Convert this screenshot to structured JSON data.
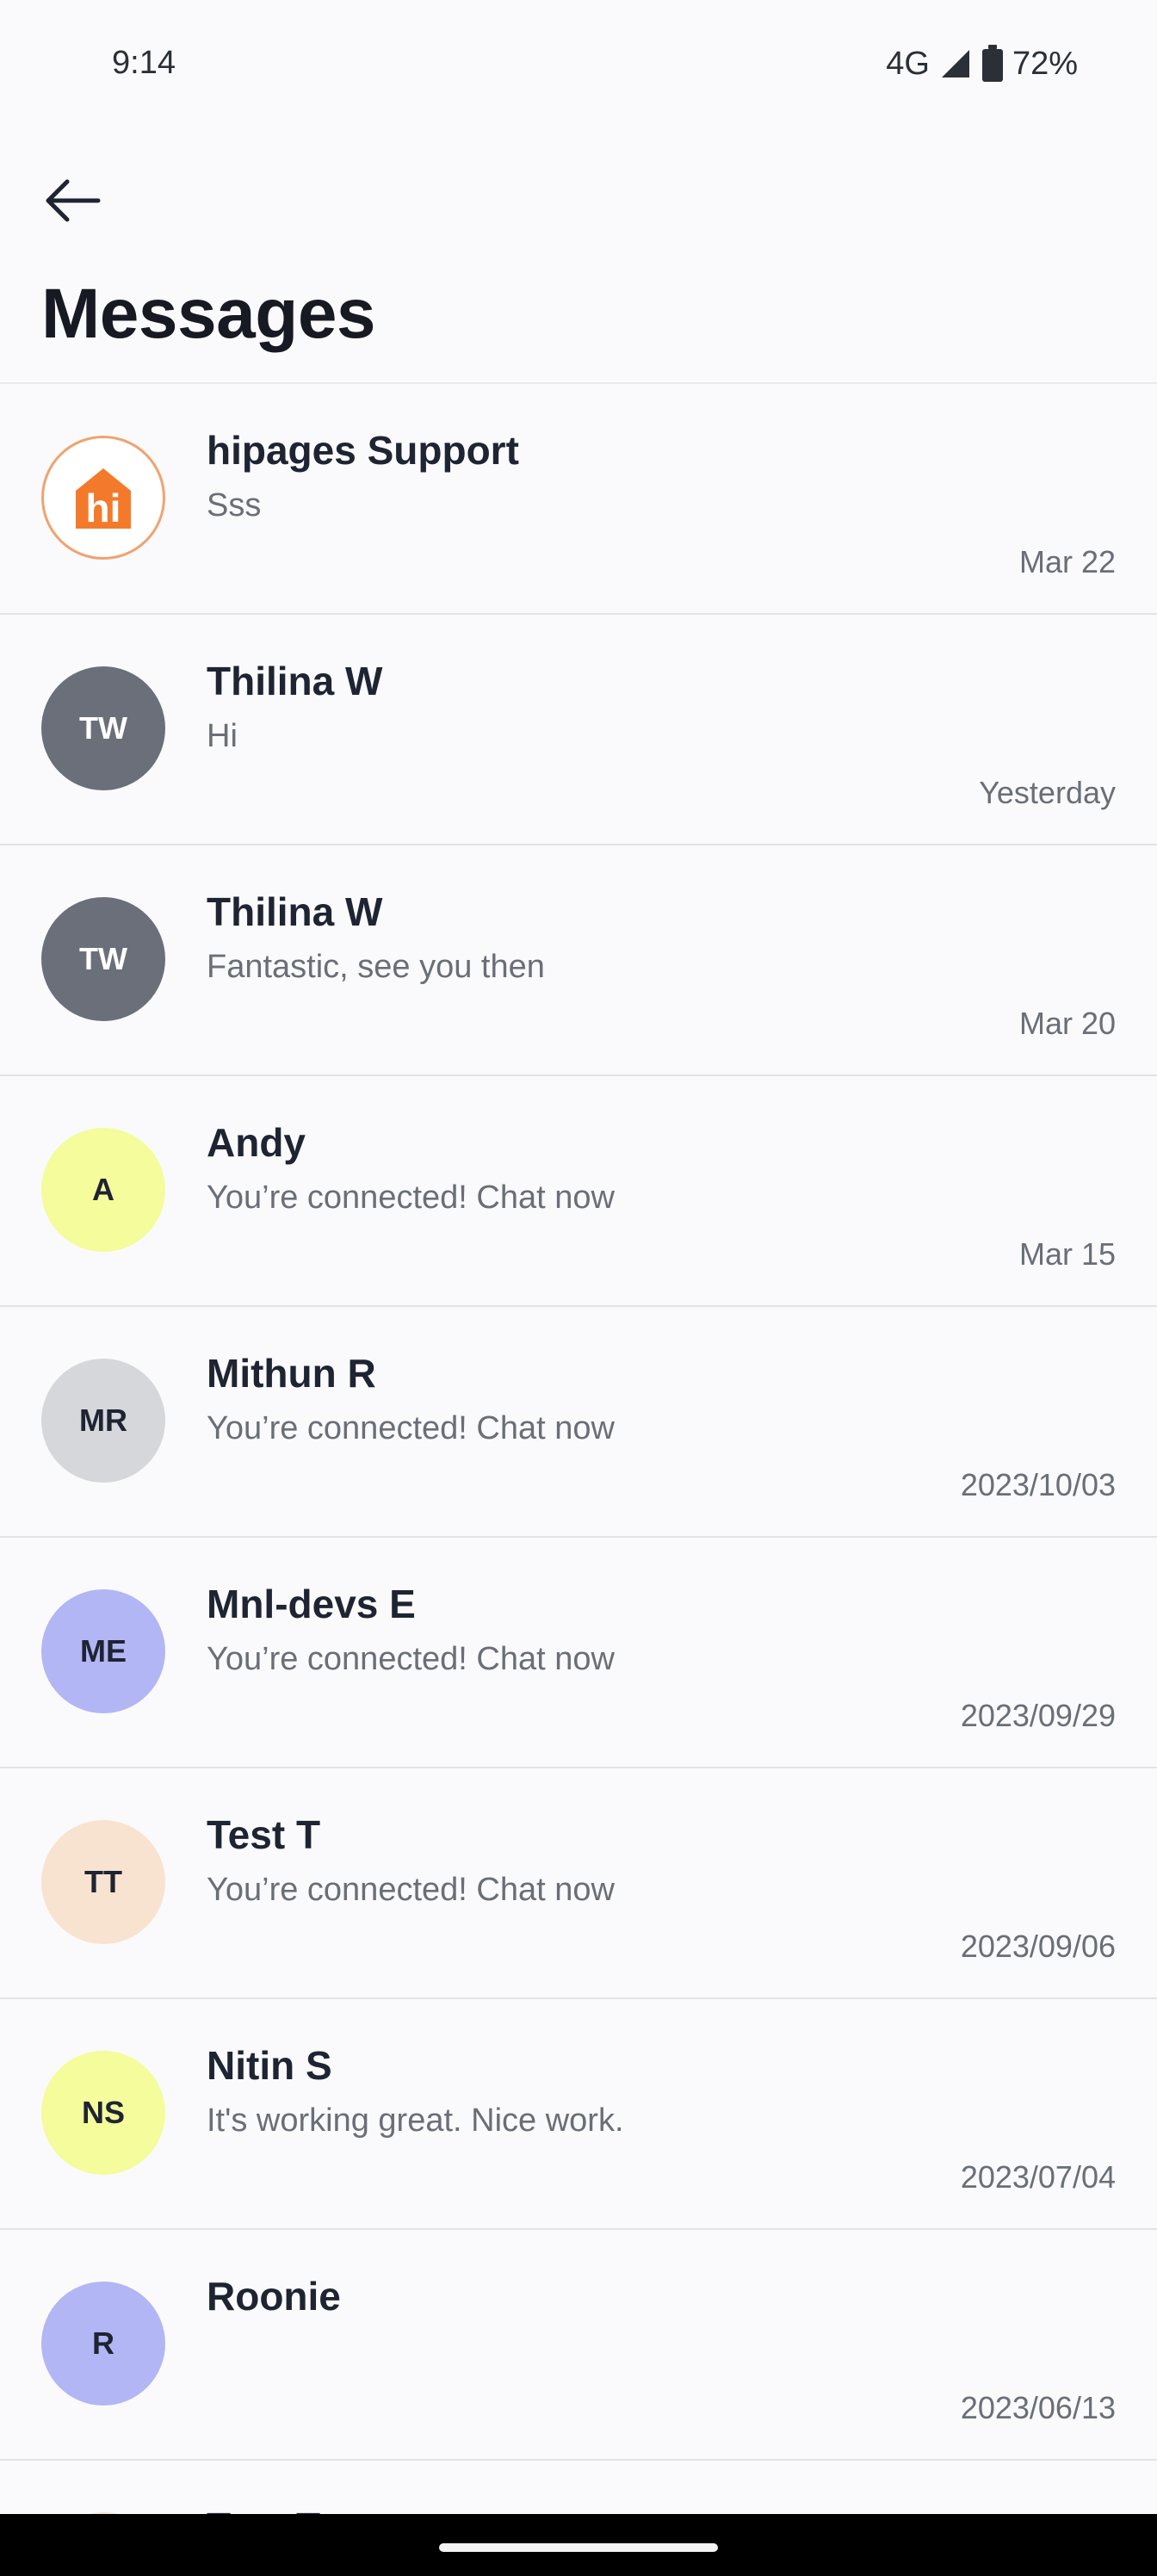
{
  "status": {
    "time": "9:14",
    "network": "4G",
    "battery": "72%"
  },
  "header": {
    "title": "Messages"
  },
  "conversations": [
    {
      "initials": "",
      "name": "hipages Support",
      "preview": "Sss",
      "time": "Mar 22",
      "avatar_color": "#FFFFFF",
      "logo": "hi"
    },
    {
      "initials": "TW",
      "name": "Thilina W",
      "preview": "Hi",
      "time": "Yesterday",
      "avatar_color": "#6B6F7A"
    },
    {
      "initials": "TW",
      "name": "Thilina W",
      "preview": "Fantastic, see you then",
      "time": "Mar 20",
      "avatar_color": "#6B6F7A"
    },
    {
      "initials": "A",
      "name": "Andy",
      "preview": "You’re connected! Chat now",
      "time": "Mar 15",
      "avatar_color": "#F4FC9B"
    },
    {
      "initials": "MR",
      "name": "Mithun R",
      "preview": "You’re connected! Chat now",
      "time": "2023/10/03",
      "avatar_color": "#D6D7DB"
    },
    {
      "initials": "ME",
      "name": "Mnl-devs E",
      "preview": "You’re connected! Chat now",
      "time": "2023/09/29",
      "avatar_color": "#B3B6F4"
    },
    {
      "initials": "TT",
      "name": "Test T",
      "preview": "You’re connected! Chat now",
      "time": "2023/09/06",
      "avatar_color": "#F7E3D0"
    },
    {
      "initials": "NS",
      "name": "Nitin S",
      "preview": "It's working great. Nice work.",
      "time": "2023/07/04",
      "avatar_color": "#F4FC9B"
    },
    {
      "initials": "R",
      "name": "Roonie",
      "preview": "",
      "time": "2023/06/13",
      "avatar_color": "#B3B6F4"
    },
    {
      "initials": "",
      "name": "Test T",
      "preview": "",
      "time": "",
      "avatar_color": "#F7E3D0"
    }
  ],
  "icons": {
    "back": "arrow-left-icon",
    "signal": "signal-icon",
    "battery": "battery-icon",
    "brand": "hipages-logo-icon"
  },
  "colors": {
    "brand_orange": "#F47A2B",
    "white_text_avatar": "#6B6F7A"
  }
}
